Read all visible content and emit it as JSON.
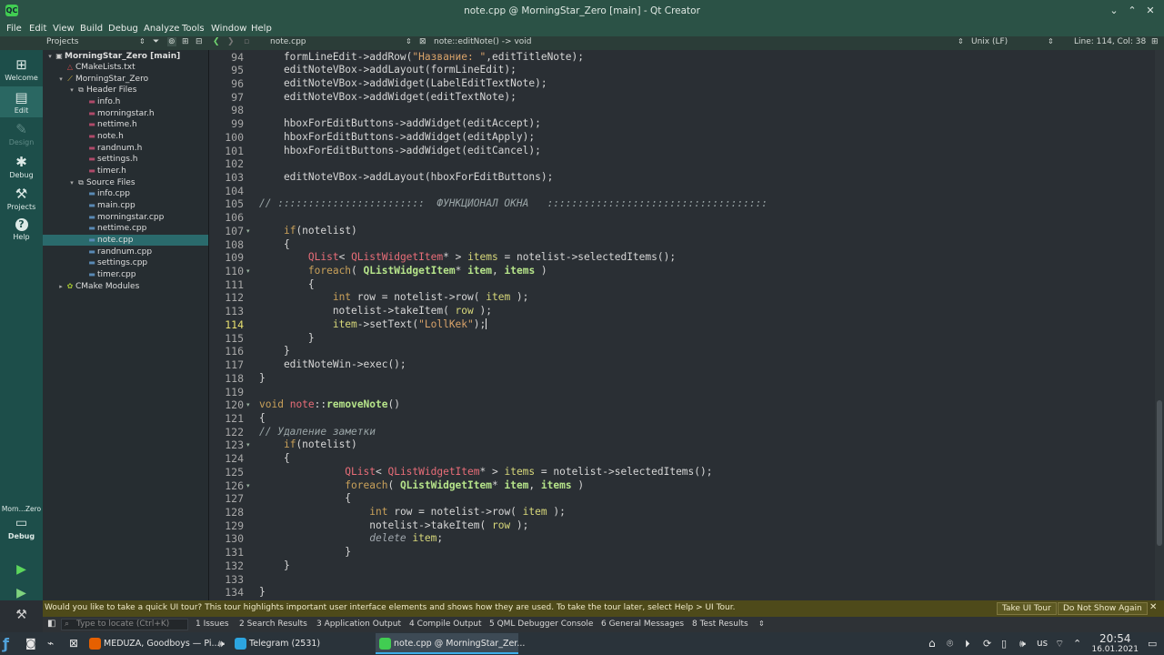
{
  "window": {
    "title": "note.cpp @ MorningStar_Zero [main] - Qt Creator"
  },
  "menu": [
    "File",
    "Edit",
    "View",
    "Build",
    "Debug",
    "Analyze",
    "Tools",
    "Window",
    "Help"
  ],
  "toolbar": {
    "projects_label": "Projects",
    "file_combo": "note.cpp",
    "symbol_combo": "note::editNote() -> void",
    "line_ending": "Unix (LF)",
    "cursor_pos": "Line: 114, Col: 38"
  },
  "modes": [
    {
      "label": "Welcome",
      "icon": "grid-icon"
    },
    {
      "label": "Edit",
      "icon": "document-icon"
    },
    {
      "label": "Design",
      "icon": "pen-icon"
    },
    {
      "label": "Debug",
      "icon": "bug-icon"
    },
    {
      "label": "Projects",
      "icon": "wrench-icon"
    },
    {
      "label": "Help",
      "icon": "help-icon"
    }
  ],
  "kit": {
    "name": "Morn...Zero",
    "label": "Debug"
  },
  "project_tree": [
    {
      "label": "MorningStar_Zero [main]",
      "depth": 0,
      "arrow": "▾",
      "bold": true,
      "icon": "project-icon"
    },
    {
      "label": "CMakeLists.txt",
      "depth": 1,
      "arrow": "",
      "icon": "cmake-icon"
    },
    {
      "label": "MorningStar_Zero",
      "depth": 1,
      "arrow": "▾",
      "icon": "target-icon"
    },
    {
      "label": "Header Files",
      "depth": 2,
      "arrow": "▾",
      "icon": "folder-icon"
    },
    {
      "label": "info.h",
      "depth": 3,
      "arrow": "",
      "icon": "header-icon"
    },
    {
      "label": "morningstar.h",
      "depth": 3,
      "arrow": "",
      "icon": "header-icon"
    },
    {
      "label": "nettime.h",
      "depth": 3,
      "arrow": "",
      "icon": "header-icon"
    },
    {
      "label": "note.h",
      "depth": 3,
      "arrow": "",
      "icon": "header-icon"
    },
    {
      "label": "randnum.h",
      "depth": 3,
      "arrow": "",
      "icon": "header-icon"
    },
    {
      "label": "settings.h",
      "depth": 3,
      "arrow": "",
      "icon": "header-icon"
    },
    {
      "label": "timer.h",
      "depth": 3,
      "arrow": "",
      "icon": "header-icon"
    },
    {
      "label": "Source Files",
      "depth": 2,
      "arrow": "▾",
      "icon": "folder-icon"
    },
    {
      "label": "info.cpp",
      "depth": 3,
      "arrow": "",
      "icon": "source-icon"
    },
    {
      "label": "main.cpp",
      "depth": 3,
      "arrow": "",
      "icon": "source-icon"
    },
    {
      "label": "morningstar.cpp",
      "depth": 3,
      "arrow": "",
      "icon": "source-icon"
    },
    {
      "label": "nettime.cpp",
      "depth": 3,
      "arrow": "",
      "icon": "source-icon"
    },
    {
      "label": "note.cpp",
      "depth": 3,
      "arrow": "",
      "icon": "source-icon",
      "selected": true
    },
    {
      "label": "randnum.cpp",
      "depth": 3,
      "arrow": "",
      "icon": "source-icon"
    },
    {
      "label": "settings.cpp",
      "depth": 3,
      "arrow": "",
      "icon": "source-icon"
    },
    {
      "label": "timer.cpp",
      "depth": 3,
      "arrow": "",
      "icon": "source-icon"
    },
    {
      "label": "CMake Modules",
      "depth": 1,
      "arrow": "▸",
      "icon": "modules-icon"
    }
  ],
  "editor": {
    "current_line": 114,
    "lines": [
      {
        "n": 94,
        "t": [
          [
            "    formLineEdit->addRow(",
            "nm"
          ],
          [
            "\"Название: \"",
            "st"
          ],
          [
            ",editTitleNote);",
            "nm"
          ]
        ]
      },
      {
        "n": 95,
        "t": [
          [
            "    editNoteVBox->addLayout(formLineEdit);",
            "nm"
          ]
        ]
      },
      {
        "n": 96,
        "t": [
          [
            "    editNoteVBox->addWidget(LabelEditTextNote);",
            "nm"
          ]
        ]
      },
      {
        "n": 97,
        "t": [
          [
            "    editNoteVBox->addWidget(editTextNote);",
            "nm"
          ]
        ]
      },
      {
        "n": 98,
        "t": []
      },
      {
        "n": 99,
        "t": [
          [
            "    hboxForEditButtons->addWidget(editAccept);",
            "nm"
          ]
        ]
      },
      {
        "n": 100,
        "t": [
          [
            "    hboxForEditButtons->addWidget(editApply);",
            "nm"
          ]
        ]
      },
      {
        "n": 101,
        "t": [
          [
            "    hboxForEditButtons->addWidget(editCancel);",
            "nm"
          ]
        ]
      },
      {
        "n": 102,
        "t": []
      },
      {
        "n": 103,
        "t": [
          [
            "    editNoteVBox->addLayout(hboxForEditButtons);",
            "nm"
          ]
        ]
      },
      {
        "n": 104,
        "t": []
      },
      {
        "n": 105,
        "t": [
          [
            "// ::::::::::::::::::::::::  ФУНКЦИОНАЛ ОКНА   ::::::::::::::::::::::::::::::::::::",
            "cm"
          ]
        ]
      },
      {
        "n": 106,
        "t": []
      },
      {
        "n": 107,
        "fold": true,
        "t": [
          [
            "    ",
            "nm"
          ],
          [
            "if",
            "kw"
          ],
          [
            "(notelist)",
            "nm"
          ]
        ]
      },
      {
        "n": 108,
        "t": [
          [
            "    {",
            "nm"
          ]
        ]
      },
      {
        "n": 109,
        "t": [
          [
            "        ",
            "nm"
          ],
          [
            "QList",
            "cls"
          ],
          [
            "< ",
            "nm"
          ],
          [
            "QListWidgetItem",
            "cls"
          ],
          [
            "* > ",
            "nm"
          ],
          [
            "items",
            "vr"
          ],
          [
            " = notelist->selectedItems();",
            "nm"
          ]
        ]
      },
      {
        "n": 110,
        "fold": true,
        "t": [
          [
            "        ",
            "nm"
          ],
          [
            "foreach",
            "kw"
          ],
          [
            "( ",
            "nm"
          ],
          [
            "QListWidgetItem",
            "tp"
          ],
          [
            "* ",
            "nm"
          ],
          [
            "item",
            "tp"
          ],
          [
            ", ",
            "nm"
          ],
          [
            "items",
            "tp"
          ],
          [
            " )",
            "nm"
          ]
        ]
      },
      {
        "n": 111,
        "t": [
          [
            "        {",
            "nm"
          ]
        ]
      },
      {
        "n": 112,
        "t": [
          [
            "            ",
            "nm"
          ],
          [
            "int",
            "kw"
          ],
          [
            " row = notelist->row( ",
            "nm"
          ],
          [
            "item",
            "vr"
          ],
          [
            " );",
            "nm"
          ]
        ]
      },
      {
        "n": 113,
        "t": [
          [
            "            notelist->takeItem( ",
            "nm"
          ],
          [
            "row",
            "vr"
          ],
          [
            " );",
            "nm"
          ]
        ]
      },
      {
        "n": 114,
        "t": [
          [
            "            ",
            "nm"
          ],
          [
            "item",
            "vr"
          ],
          [
            "->setText(",
            "nm"
          ],
          [
            "\"LollKek\"",
            "st"
          ],
          [
            ");",
            "nm"
          ]
        ]
      },
      {
        "n": 115,
        "t": [
          [
            "        }",
            "nm"
          ]
        ]
      },
      {
        "n": 116,
        "t": [
          [
            "    }",
            "nm"
          ]
        ]
      },
      {
        "n": 117,
        "t": [
          [
            "    editNoteWin->exec();",
            "nm"
          ]
        ]
      },
      {
        "n": 118,
        "t": [
          [
            "}",
            "nm"
          ]
        ]
      },
      {
        "n": 119,
        "t": []
      },
      {
        "n": 120,
        "fold": true,
        "t": [
          [
            "void",
            "kw"
          ],
          [
            " ",
            "nm"
          ],
          [
            "note",
            "cls"
          ],
          [
            "::",
            "nm"
          ],
          [
            "removeNote",
            "tp"
          ],
          [
            "()",
            "nm"
          ]
        ]
      },
      {
        "n": 121,
        "t": [
          [
            "{",
            "nm"
          ]
        ]
      },
      {
        "n": 122,
        "t": [
          [
            "// Удаление заметки",
            "cm"
          ]
        ]
      },
      {
        "n": 123,
        "fold": true,
        "t": [
          [
            "    ",
            "nm"
          ],
          [
            "if",
            "kw"
          ],
          [
            "(notelist)",
            "nm"
          ]
        ]
      },
      {
        "n": 124,
        "t": [
          [
            "    {",
            "nm"
          ]
        ]
      },
      {
        "n": 125,
        "t": [
          [
            "              ",
            "nm"
          ],
          [
            "QList",
            "cls"
          ],
          [
            "< ",
            "nm"
          ],
          [
            "QListWidgetItem",
            "cls"
          ],
          [
            "* > ",
            "nm"
          ],
          [
            "items",
            "vr"
          ],
          [
            " = notelist->selectedItems();",
            "nm"
          ]
        ]
      },
      {
        "n": 126,
        "fold": true,
        "t": [
          [
            "              ",
            "nm"
          ],
          [
            "foreach",
            "kw"
          ],
          [
            "( ",
            "nm"
          ],
          [
            "QListWidgetItem",
            "tp"
          ],
          [
            "* ",
            "nm"
          ],
          [
            "item",
            "tp"
          ],
          [
            ", ",
            "nm"
          ],
          [
            "items",
            "tp"
          ],
          [
            " )",
            "nm"
          ]
        ]
      },
      {
        "n": 127,
        "t": [
          [
            "              {",
            "nm"
          ]
        ]
      },
      {
        "n": 128,
        "t": [
          [
            "                  ",
            "nm"
          ],
          [
            "int",
            "kw"
          ],
          [
            " row = notelist->row( ",
            "nm"
          ],
          [
            "item",
            "vr"
          ],
          [
            " );",
            "nm"
          ]
        ]
      },
      {
        "n": 129,
        "t": [
          [
            "                  notelist->takeItem( ",
            "nm"
          ],
          [
            "row",
            "vr"
          ],
          [
            " );",
            "nm"
          ]
        ]
      },
      {
        "n": 130,
        "t": [
          [
            "                  ",
            "nm"
          ],
          [
            "delete",
            "it"
          ],
          [
            " ",
            "nm"
          ],
          [
            "item",
            "vr"
          ],
          [
            ";",
            "nm"
          ]
        ]
      },
      {
        "n": 131,
        "t": [
          [
            "              }",
            "nm"
          ]
        ]
      },
      {
        "n": 132,
        "t": [
          [
            "    }",
            "nm"
          ]
        ]
      },
      {
        "n": 133,
        "t": []
      },
      {
        "n": 134,
        "t": [
          [
            "}",
            "nm"
          ]
        ]
      }
    ]
  },
  "tour": {
    "message": "Would you like to take a quick UI tour? This tour highlights important user interface elements and shows how they are used. To take the tour later, select Help > UI Tour.",
    "take_button": "Take UI Tour",
    "dismiss_button": "Do Not Show Again"
  },
  "output": {
    "locate_placeholder": "Type to locate (Ctrl+K)",
    "panes": [
      "1  Issues",
      "2  Search Results",
      "3  Application Output",
      "4  Compile Output",
      "5  QML Debugger Console",
      "6  General Messages",
      "8  Test Results"
    ]
  },
  "taskbar": {
    "tasks": [
      {
        "label": "MEDUZA, Goodboys — Pi...",
        "color": "#e66000",
        "active": false
      },
      {
        "label": "Telegram (2531)",
        "color": "#2ca5e0",
        "active": false
      },
      {
        "label": "note.cpp @ MorningStar_Zer...",
        "color": "#41cd52",
        "active": true
      }
    ],
    "keyboard": "us",
    "time": "20:54",
    "date": "16.01.2021"
  }
}
